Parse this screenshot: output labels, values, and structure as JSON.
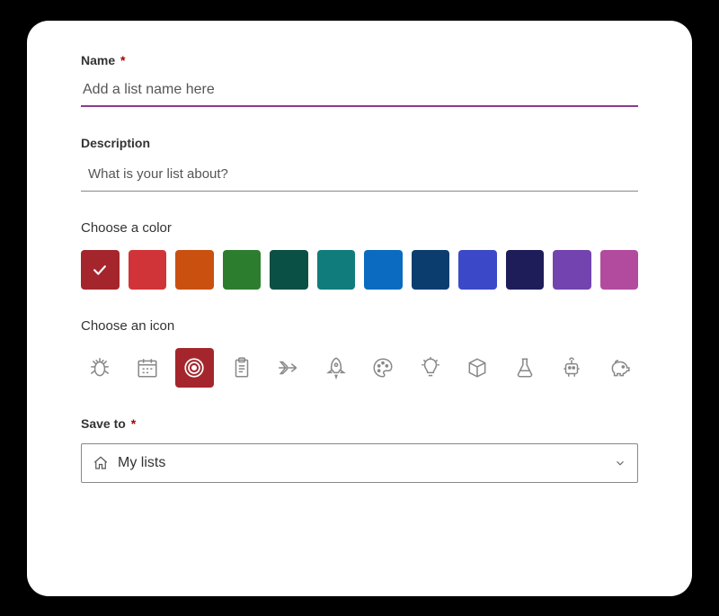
{
  "name": {
    "label": "Name",
    "required_mark": "*",
    "placeholder": "Add a list name here",
    "value": ""
  },
  "description": {
    "label": "Description",
    "placeholder": "What is your list about?",
    "value": ""
  },
  "color": {
    "label": "Choose a color",
    "selected_index": 0,
    "options": [
      {
        "name": "dark-red",
        "hex": "#a4262c"
      },
      {
        "name": "red",
        "hex": "#d13438"
      },
      {
        "name": "orange",
        "hex": "#ca5010"
      },
      {
        "name": "green",
        "hex": "#2d7d2e"
      },
      {
        "name": "dark-teal",
        "hex": "#0b5044"
      },
      {
        "name": "teal",
        "hex": "#107c7b"
      },
      {
        "name": "blue",
        "hex": "#0b6bc0"
      },
      {
        "name": "dark-blue",
        "hex": "#0b3e6f"
      },
      {
        "name": "indigo",
        "hex": "#3b49c9"
      },
      {
        "name": "navy",
        "hex": "#1e1d5a"
      },
      {
        "name": "purple",
        "hex": "#7343af"
      },
      {
        "name": "magenta",
        "hex": "#b24b9e"
      }
    ]
  },
  "icon": {
    "label": "Choose an icon",
    "selected_index": 2,
    "selected_bg": "#a4262c",
    "options": [
      "bug",
      "calendar",
      "target",
      "clipboard",
      "airplane",
      "rocket",
      "palette",
      "lightbulb",
      "cube",
      "flask",
      "robot",
      "piggy-bank"
    ]
  },
  "save_to": {
    "label": "Save to",
    "required_mark": "*",
    "selected_label": "My lists"
  }
}
